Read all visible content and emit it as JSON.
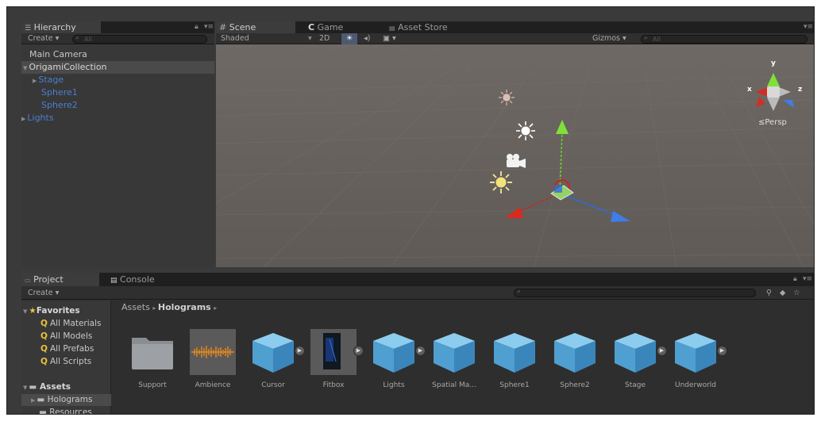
{
  "hierarchy": {
    "tab_label": "Hierarchy",
    "create_label": "Create ▾",
    "search_placeholder": "All",
    "items": [
      {
        "label": "Main Camera"
      },
      {
        "label": "OrigamiCollection"
      },
      {
        "label": "Stage"
      },
      {
        "label": "Sphere1"
      },
      {
        "label": "Sphere2"
      },
      {
        "label": "Lights"
      }
    ]
  },
  "scene": {
    "tabs": [
      {
        "label": "Scene"
      },
      {
        "label": "Game"
      },
      {
        "label": "Asset Store"
      }
    ],
    "shading_mode": "Shaded",
    "toggle_2d": "2D",
    "gizmos_label": "Gizmos ▾",
    "search_placeholder": "All",
    "axis_y": "y",
    "axis_x": "x",
    "axis_z": "z",
    "projection_label": "≤Persp"
  },
  "project": {
    "tabs": [
      {
        "label": "Project"
      },
      {
        "label": "Console"
      }
    ],
    "create_label": "Create ▾",
    "favorites_label": "Favorites",
    "favorites": [
      {
        "label": "All Materials"
      },
      {
        "label": "All Models"
      },
      {
        "label": "All Prefabs"
      },
      {
        "label": "All Scripts"
      }
    ],
    "assets_label": "Assets",
    "assets_children": [
      {
        "label": "Holograms"
      },
      {
        "label": "Resources"
      }
    ],
    "breadcrumb_root": "Assets",
    "breadcrumb_current": "Holograms",
    "assets": [
      {
        "label": "Support",
        "kind": "folder-icon"
      },
      {
        "label": "Ambience",
        "kind": "audio-icon"
      },
      {
        "label": "Cursor",
        "kind": "cube-icon"
      },
      {
        "label": "Fitbox",
        "kind": "image-icon"
      },
      {
        "label": "Lights",
        "kind": "cube-icon"
      },
      {
        "label": "Spatial Ma...",
        "kind": "cube-icon"
      },
      {
        "label": "Sphere1",
        "kind": "cube-icon"
      },
      {
        "label": "Sphere2",
        "kind": "cube-icon"
      },
      {
        "label": "Stage",
        "kind": "cube-icon"
      },
      {
        "label": "Underworld",
        "kind": "cube-icon"
      }
    ]
  },
  "colors": {
    "selection_blue": "#4b7fd0",
    "scene_bg": "#6a6561",
    "favorite_yellow": "#e8c23a",
    "axis_red": "#c8261e",
    "axis_green": "#6fcf2c",
    "axis_blue": "#2f6bd6"
  }
}
